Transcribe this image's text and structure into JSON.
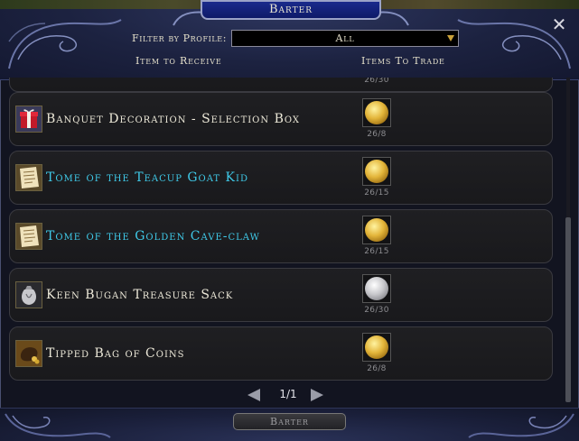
{
  "window": {
    "title": "Barter",
    "close_glyph": "✕"
  },
  "filter": {
    "label": "Filter by Profile:",
    "selected": "All"
  },
  "columns": {
    "receive": "Item to Receive",
    "trade": "Items To Trade"
  },
  "partial_row": {
    "cost_qty": "26/30"
  },
  "items": [
    {
      "name": "Banquet Decoration - Selection Box",
      "rarity_color": "#ece8d8",
      "icon": "gift-box-icon",
      "cost_icon": "gold-coin-icon",
      "cost_qty": "26/8"
    },
    {
      "name": "Tome of the Teacup Goat Kid",
      "rarity_color": "#3fc9e8",
      "icon": "scroll-icon",
      "cost_icon": "gold-coin-icon",
      "cost_qty": "26/15"
    },
    {
      "name": "Tome of the Golden Cave-claw",
      "rarity_color": "#3fc9e8",
      "icon": "scroll-icon",
      "cost_icon": "gold-coin-icon",
      "cost_qty": "26/15"
    },
    {
      "name": "Keen Bugan Treasure Sack",
      "rarity_color": "#ece8d8",
      "icon": "treasure-sack-icon",
      "cost_icon": "silver-coin-icon",
      "cost_qty": "26/30"
    },
    {
      "name": "Tipped Bag of Coins",
      "rarity_color": "#ece8d8",
      "icon": "coin-bag-icon",
      "cost_icon": "gold-coin-icon",
      "cost_qty": "26/8"
    }
  ],
  "pager": {
    "label": "1/1"
  },
  "barter_button": {
    "label": "Barter"
  }
}
